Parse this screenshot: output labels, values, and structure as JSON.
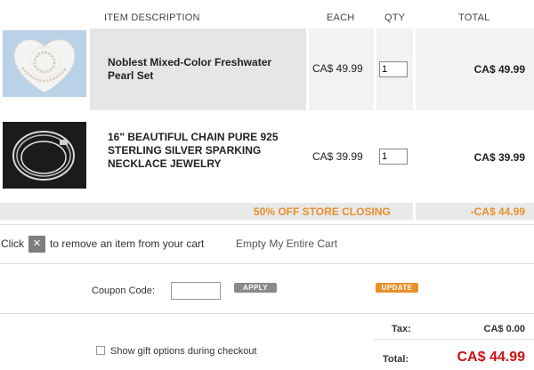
{
  "header": {
    "item_description": "ITEM  DESCRIPTION",
    "each": "EACH",
    "qty": "QTY",
    "total": "TOTAL"
  },
  "items": [
    {
      "name": "Noblest Mixed-Color Freshwater Pearl Set",
      "each": "CA$ 49.99",
      "qty": "1",
      "total": "CA$ 49.99",
      "image_icon": "pearl-set-thumbnail"
    },
    {
      "name": "16\" BEAUTIFUL CHAIN PURE 925 STERLING SILVER SPARKING NECKLACE JEWELRY",
      "each": "CA$ 39.99",
      "qty": "1",
      "total": "CA$ 39.99",
      "image_icon": "silver-chain-thumbnail"
    }
  ],
  "discount": {
    "label": "50% OFF STORE CLOSING",
    "amount": "-CA$ 44.99",
    "color": "#e8912c"
  },
  "remove_hint": {
    "prefix": "Click",
    "button_glyph": "✕",
    "suffix": "to remove an item from your cart",
    "empty_cart": "Empty My Entire Cart"
  },
  "coupon": {
    "label": "Coupon Code:",
    "value": "",
    "apply": "APPLY",
    "update": "UPDATE",
    "update_color": "#e8912c"
  },
  "totals": {
    "tax_label": "Tax:",
    "tax_value": "CA$ 0.00",
    "total_label": "Total:",
    "total_value": "CA$ 44.99",
    "total_color": "#cc1111"
  },
  "gift": {
    "label": "Show gift options during checkout",
    "checked": false
  }
}
